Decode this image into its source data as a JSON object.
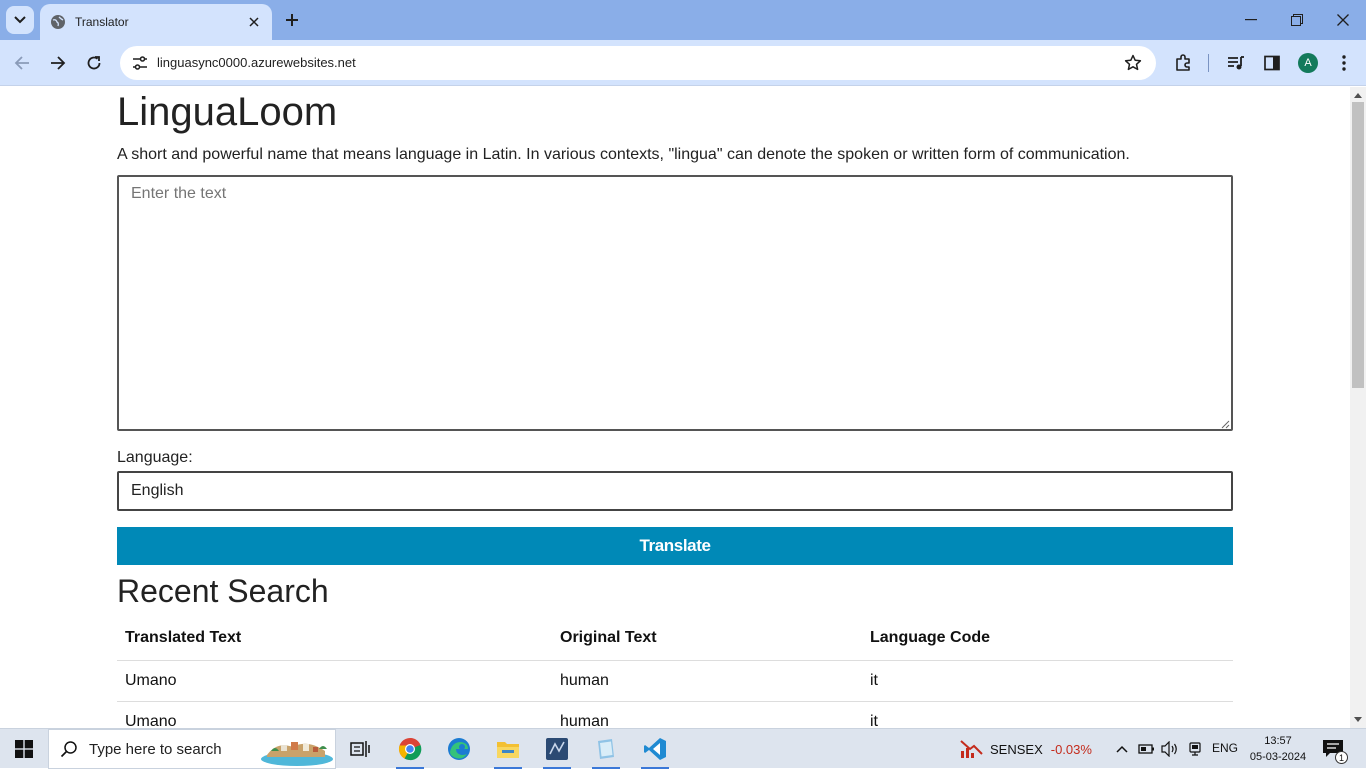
{
  "browser": {
    "tab": {
      "title": "Translator"
    },
    "address_bar": {
      "url": "linguasync0000.azurewebsites.net"
    },
    "profile_initial": "A"
  },
  "page": {
    "title": "LinguaLoom",
    "description": "A short and powerful name that means language in Latin. In various contexts, \"lingua\" can denote the spoken or written form of communication.",
    "text_input": {
      "placeholder": "Enter the text",
      "value": ""
    },
    "language_label": "Language:",
    "language_input": {
      "value": "English"
    },
    "translate_button": "Translate",
    "recent_search": {
      "title": "Recent Search",
      "columns": [
        "Translated Text",
        "Original Text",
        "Language Code"
      ],
      "rows": [
        [
          "Umano",
          "human",
          "it"
        ],
        [
          "Umano",
          "human",
          "it"
        ]
      ]
    }
  },
  "taskbar": {
    "search_placeholder": "Type here to search",
    "sensex": {
      "label": "SENSEX",
      "change": "-0.03%",
      "change_color": "#c42b1c"
    },
    "language": "ENG",
    "time": "13:57",
    "date": "05-03-2024",
    "notification_count": "1"
  },
  "colors": {
    "accent": "#0089b7",
    "chrome_tabbar": "#8aaee8",
    "chrome_toolbar": "#d3e3fd"
  }
}
